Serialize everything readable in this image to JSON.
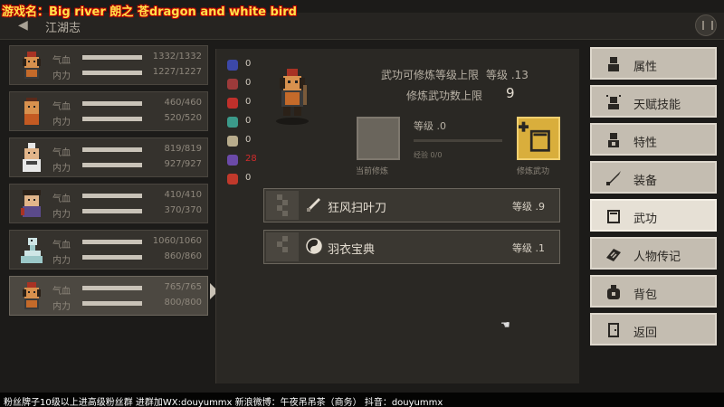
{
  "stream": {
    "title": "游戏名：Big river 朗之 苍dragon and white bird",
    "footer": "粉丝牌子10级以上进高级粉丝群  进群加WX:douyummx 新浪微博：午夜吊吊茶（商务）    抖音：douyummx"
  },
  "topbar": {
    "title": "江湖志"
  },
  "party": [
    {
      "hp_label": "气血",
      "mp_label": "内力",
      "hp": "1332/1332",
      "mp": "1227/1227",
      "hp_frac": 1.0,
      "mp_frac": 1.0
    },
    {
      "hp_label": "气血",
      "mp_label": "内力",
      "hp": "460/460",
      "mp": "520/520",
      "hp_frac": 1.0,
      "mp_frac": 1.0
    },
    {
      "hp_label": "气血",
      "mp_label": "内力",
      "hp": "819/819",
      "mp": "927/927",
      "hp_frac": 1.0,
      "mp_frac": 1.0
    },
    {
      "hp_label": "气血",
      "mp_label": "内力",
      "hp": "410/410",
      "mp": "370/370",
      "hp_frac": 1.0,
      "mp_frac": 1.0
    },
    {
      "hp_label": "气血",
      "mp_label": "内力",
      "hp": "1060/1060",
      "mp": "860/860",
      "hp_frac": 1.0,
      "mp_frac": 1.0
    },
    {
      "hp_label": "气血",
      "mp_label": "内力",
      "hp": "765/765",
      "mp": "800/800",
      "hp_frac": 1.0,
      "mp_frac": 1.0
    }
  ],
  "resources": [
    {
      "icon": "blue-skull-icon",
      "color": "#3c48a8",
      "value": "0"
    },
    {
      "icon": "broken-heart-icon",
      "color": "#9c3a3a",
      "value": "0"
    },
    {
      "icon": "red-gem-icon",
      "color": "#c0302b",
      "value": "0"
    },
    {
      "icon": "teal-skull-icon",
      "color": "#3b9a8a",
      "value": "0"
    },
    {
      "icon": "star-icon",
      "color": "#b8ac8c",
      "value": "0"
    },
    {
      "icon": "purple-orb-icon",
      "color": "#6b4aa8",
      "value": "28"
    },
    {
      "icon": "fire-icon",
      "color": "#c0392b",
      "value": "0"
    }
  ],
  "martial": {
    "limit_label": "武功可修炼等级上限",
    "limit_level": "等级 .13",
    "count_label": "修炼武功数上限",
    "count_value": "9",
    "level_label": "等级 .0",
    "progress_label": "经验 0/0",
    "progress_frac": 0,
    "current_label": "当前修炼",
    "book_label": "修炼武功"
  },
  "skills": [
    {
      "name": "狂风扫叶刀",
      "level": "等级 .9",
      "icon": "blade-icon"
    },
    {
      "name": "羽衣宝典",
      "level": "等级 .1",
      "icon": "yin-yang-icon"
    }
  ],
  "menu": [
    {
      "label": "属性",
      "icon": "person-icon",
      "active": false
    },
    {
      "label": "天赋技能",
      "icon": "talent-icon",
      "active": false
    },
    {
      "label": "特性",
      "icon": "trait-icon",
      "active": false
    },
    {
      "label": "装备",
      "icon": "sword-icon",
      "active": false
    },
    {
      "label": "武功",
      "icon": "book-icon",
      "active": true
    },
    {
      "label": "人物传记",
      "icon": "scroll-icon",
      "active": false
    },
    {
      "label": "背包",
      "icon": "bag-icon",
      "active": false
    },
    {
      "label": "返回",
      "icon": "door-icon",
      "active": false
    }
  ],
  "colors": {
    "accent_gold": "#d9ae3c",
    "menu_bg": "#c4bdb1",
    "panel_bg": "#2a2824"
  }
}
